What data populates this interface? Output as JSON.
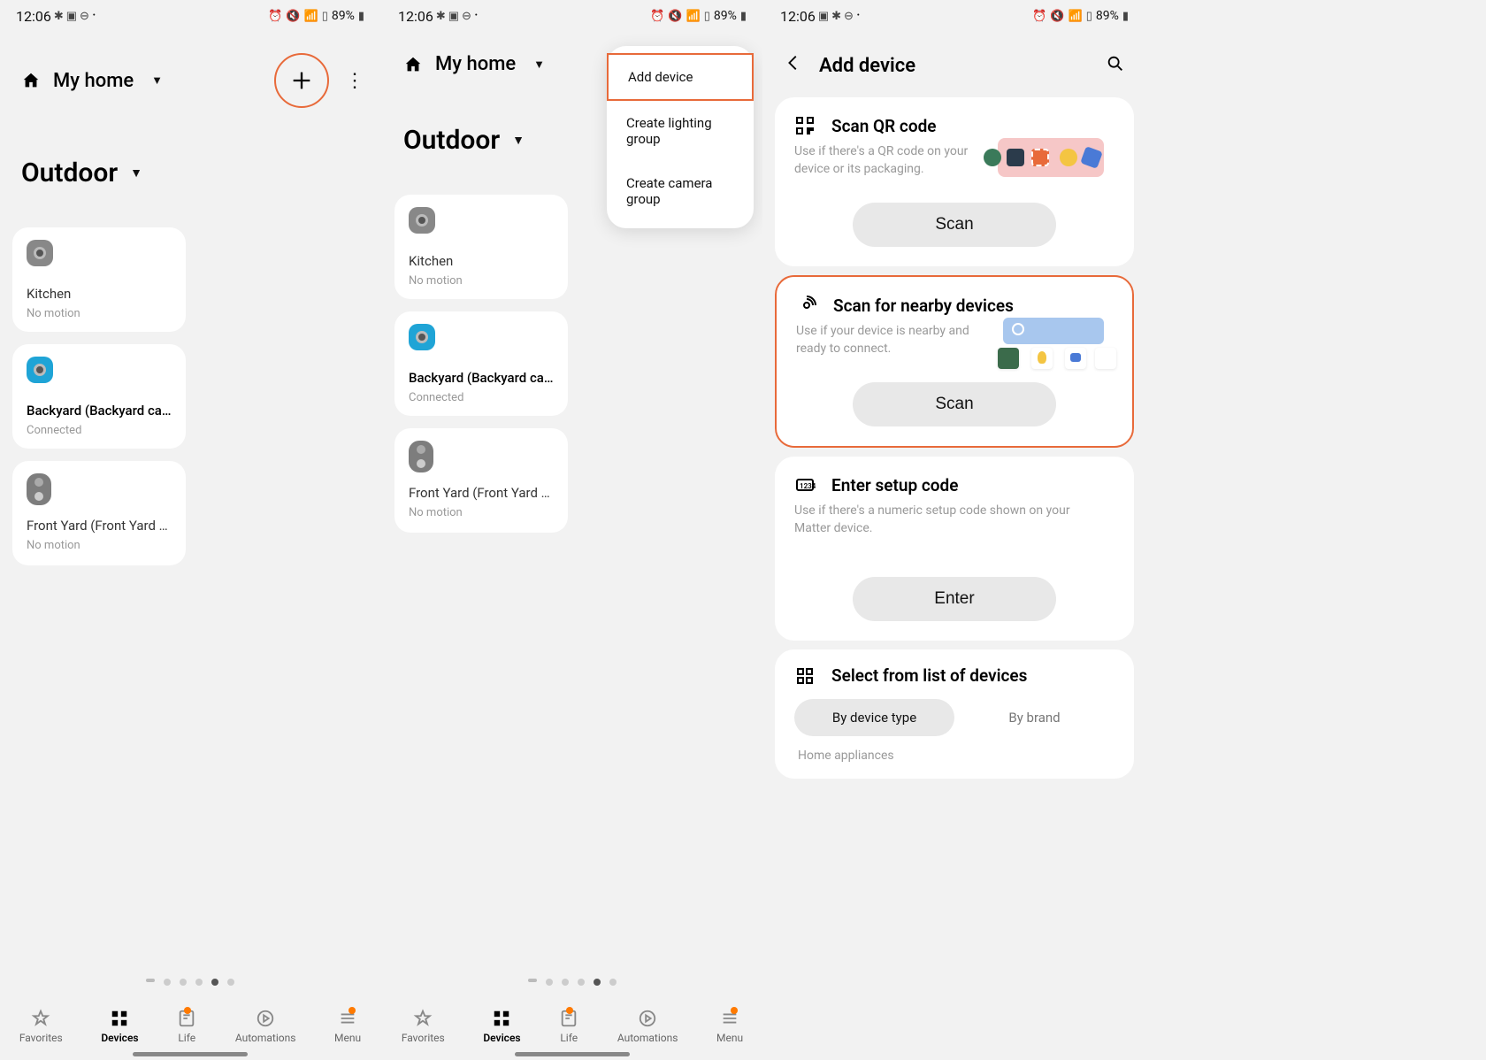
{
  "status": {
    "time": "12:06",
    "battery": "89%"
  },
  "header": {
    "home_label": "My home"
  },
  "room": "Outdoor",
  "devices": [
    {
      "id": "kitchen",
      "title": "Kitchen",
      "sub": "No motion",
      "active": false,
      "icon": "camera"
    },
    {
      "id": "backyard",
      "title": "Backyard (Backyard camera)",
      "sub": "Connected",
      "active": true,
      "icon": "camera"
    },
    {
      "id": "frontyard",
      "title": "Front Yard (Front Yard doorbell)",
      "sub": "No motion",
      "active": false,
      "icon": "doorbell"
    }
  ],
  "menu": {
    "items": [
      "Add device",
      "Create lighting group",
      "Create camera group"
    ],
    "highlighted": 0
  },
  "nav": {
    "items": [
      "Favorites",
      "Devices",
      "Life",
      "Automations",
      "Menu"
    ],
    "active": 1,
    "badges": [
      false,
      false,
      true,
      false,
      true
    ]
  },
  "screen3": {
    "title": "Add device",
    "panels": [
      {
        "id": "qr",
        "title": "Scan QR code",
        "desc": "Use if there's a QR code on your device or its packaging.",
        "button": "Scan"
      },
      {
        "id": "nearby",
        "title": "Scan for nearby devices",
        "desc": "Use if your device is nearby and ready to connect.",
        "button": "Scan"
      },
      {
        "id": "code",
        "title": "Enter setup code",
        "desc": "Use if there's a numeric setup code shown on your Matter device.",
        "button": "Enter"
      }
    ],
    "highlighted_panel": 1,
    "list": {
      "title": "Select from list of devices",
      "pills": [
        "By device type",
        "By brand"
      ],
      "active_pill": 0,
      "row": "Home appliances"
    }
  }
}
